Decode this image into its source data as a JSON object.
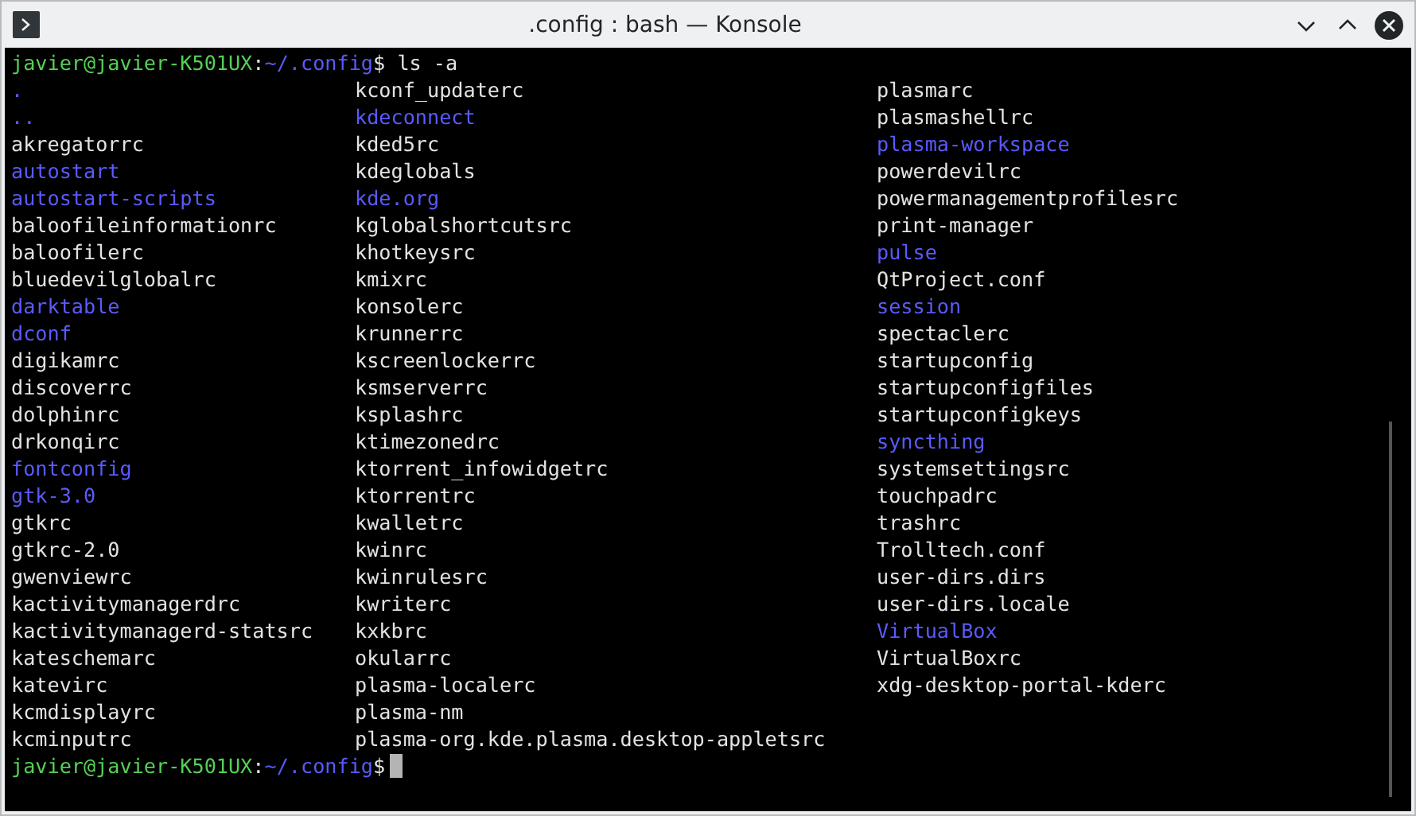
{
  "window": {
    "title": ".config : bash — Konsole"
  },
  "terminal": {
    "command_prompt": {
      "user_host": "javier@javier-K501UX",
      "separator": ":",
      "path": "~/.config",
      "symbol": "$",
      "command": "ls -a"
    },
    "listing_columns": [
      [
        {
          "name": ".",
          "kind": "dir"
        },
        {
          "name": "..",
          "kind": "dir"
        },
        {
          "name": "akregatorrc",
          "kind": "file"
        },
        {
          "name": "autostart",
          "kind": "dir"
        },
        {
          "name": "autostart-scripts",
          "kind": "dir"
        },
        {
          "name": "baloofileinformationrc",
          "kind": "file"
        },
        {
          "name": "baloofilerc",
          "kind": "file"
        },
        {
          "name": "bluedevilglobalrc",
          "kind": "file"
        },
        {
          "name": "darktable",
          "kind": "dir"
        },
        {
          "name": "dconf",
          "kind": "dir"
        },
        {
          "name": "digikamrc",
          "kind": "file"
        },
        {
          "name": "discoverrc",
          "kind": "file"
        },
        {
          "name": "dolphinrc",
          "kind": "file"
        },
        {
          "name": "drkonqirc",
          "kind": "file"
        },
        {
          "name": "fontconfig",
          "kind": "dir"
        },
        {
          "name": "gtk-3.0",
          "kind": "dir"
        },
        {
          "name": "gtkrc",
          "kind": "file"
        },
        {
          "name": "gtkrc-2.0",
          "kind": "file"
        },
        {
          "name": "gwenviewrc",
          "kind": "file"
        },
        {
          "name": "kactivitymanagerdrc",
          "kind": "file"
        },
        {
          "name": "kactivitymanagerd-statsrc",
          "kind": "file"
        },
        {
          "name": "kateschemarc",
          "kind": "file"
        },
        {
          "name": "katevirc",
          "kind": "file"
        },
        {
          "name": "kcmdisplayrc",
          "kind": "file"
        },
        {
          "name": "kcminputrc",
          "kind": "file"
        }
      ],
      [
        {
          "name": "kconf_updaterc",
          "kind": "file"
        },
        {
          "name": "kdeconnect",
          "kind": "dir"
        },
        {
          "name": "kded5rc",
          "kind": "file"
        },
        {
          "name": "kdeglobals",
          "kind": "file"
        },
        {
          "name": "kde.org",
          "kind": "dir"
        },
        {
          "name": "kglobalshortcutsrc",
          "kind": "file"
        },
        {
          "name": "khotkeysrc",
          "kind": "file"
        },
        {
          "name": "kmixrc",
          "kind": "file"
        },
        {
          "name": "konsolerc",
          "kind": "file"
        },
        {
          "name": "krunnerrc",
          "kind": "file"
        },
        {
          "name": "kscreenlockerrc",
          "kind": "file"
        },
        {
          "name": "ksmserverrc",
          "kind": "file"
        },
        {
          "name": "ksplashrc",
          "kind": "file"
        },
        {
          "name": "ktimezonedrc",
          "kind": "file"
        },
        {
          "name": "ktorrent_infowidgetrc",
          "kind": "file"
        },
        {
          "name": "ktorrentrc",
          "kind": "file"
        },
        {
          "name": "kwalletrc",
          "kind": "file"
        },
        {
          "name": "kwinrc",
          "kind": "file"
        },
        {
          "name": "kwinrulesrc",
          "kind": "file"
        },
        {
          "name": "kwriterc",
          "kind": "file"
        },
        {
          "name": "kxkbrc",
          "kind": "file"
        },
        {
          "name": "okularrc",
          "kind": "file"
        },
        {
          "name": "plasma-localerc",
          "kind": "file"
        },
        {
          "name": "plasma-nm",
          "kind": "file"
        },
        {
          "name": "plasma-org.kde.plasma.desktop-appletsrc",
          "kind": "file"
        }
      ],
      [
        {
          "name": "plasmarc",
          "kind": "file"
        },
        {
          "name": "plasmashellrc",
          "kind": "file"
        },
        {
          "name": "plasma-workspace",
          "kind": "dir"
        },
        {
          "name": "powerdevilrc",
          "kind": "file"
        },
        {
          "name": "powermanagementprofilesrc",
          "kind": "file"
        },
        {
          "name": "print-manager",
          "kind": "file"
        },
        {
          "name": "pulse",
          "kind": "dir"
        },
        {
          "name": "QtProject.conf",
          "kind": "file"
        },
        {
          "name": "session",
          "kind": "dir"
        },
        {
          "name": "spectaclerc",
          "kind": "file"
        },
        {
          "name": "startupconfig",
          "kind": "file"
        },
        {
          "name": "startupconfigfiles",
          "kind": "file"
        },
        {
          "name": "startupconfigkeys",
          "kind": "file"
        },
        {
          "name": "syncthing",
          "kind": "dir"
        },
        {
          "name": "systemsettingsrc",
          "kind": "file"
        },
        {
          "name": "touchpadrc",
          "kind": "file"
        },
        {
          "name": "trashrc",
          "kind": "file"
        },
        {
          "name": "Trolltech.conf",
          "kind": "file"
        },
        {
          "name": "user-dirs.dirs",
          "kind": "file"
        },
        {
          "name": "user-dirs.locale",
          "kind": "file"
        },
        {
          "name": "VirtualBox",
          "kind": "dir"
        },
        {
          "name": "VirtualBoxrc",
          "kind": "file"
        },
        {
          "name": "xdg-desktop-portal-kderc",
          "kind": "file"
        }
      ]
    ],
    "current_prompt": {
      "user_host": "javier@javier-K501UX",
      "separator": ":",
      "path": "~/.config",
      "symbol": "$"
    }
  }
}
